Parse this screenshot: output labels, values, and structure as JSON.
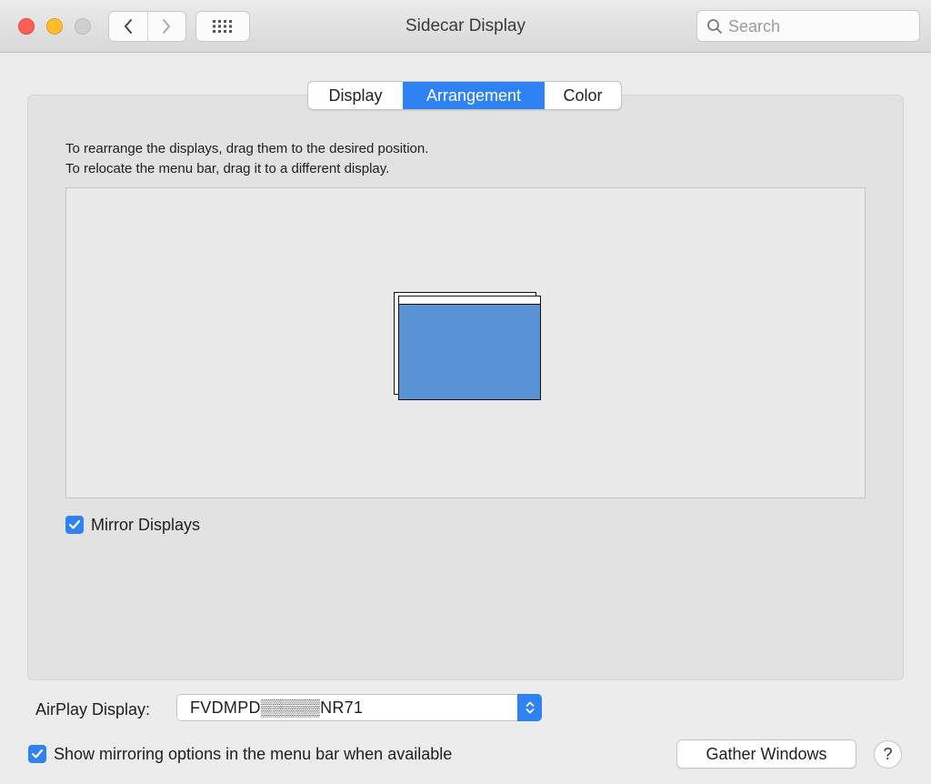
{
  "window": {
    "title": "Sidecar Display"
  },
  "search": {
    "placeholder": "Search"
  },
  "tabs": [
    {
      "label": "Display",
      "selected": false
    },
    {
      "label": "Arrangement",
      "selected": true
    },
    {
      "label": "Color",
      "selected": false
    }
  ],
  "arrangement": {
    "instruction_line1": "To rearrange the displays, drag them to the desired position.",
    "instruction_line2": "To relocate the menu bar, drag it to a different display."
  },
  "mirror": {
    "label": "Mirror Displays",
    "checked": true
  },
  "airplay": {
    "label": "AirPlay Display:",
    "value": "FVDMPD▒▒▒▒▒NR71"
  },
  "menu_bar_option": {
    "label": "Show mirroring options in the menu bar when available",
    "checked": true
  },
  "buttons": {
    "gather": "Gather Windows",
    "help": "?"
  },
  "colors": {
    "accent": "#2f82f4",
    "display_fill": "#5a93d4",
    "traffic_close": "#fe5f57",
    "traffic_min": "#febc2e"
  }
}
